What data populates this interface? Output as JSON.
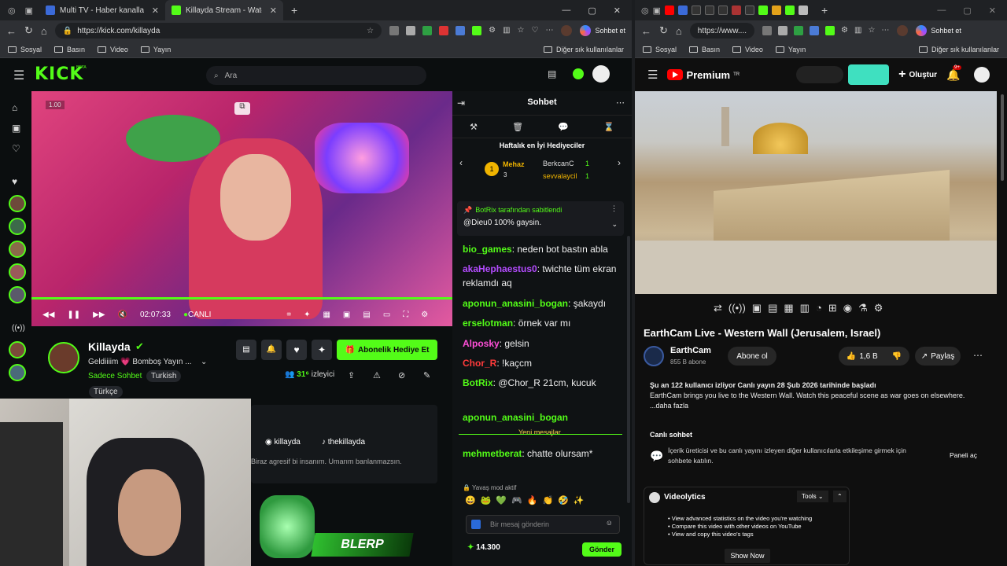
{
  "left_browser": {
    "tabs": [
      {
        "title": "Multi TV - Haber kanallarını aynı a",
        "active": false
      },
      {
        "title": "Killayda Stream - Watch Live on Ki",
        "active": true
      }
    ],
    "url": "https://kick.com/killayda",
    "copilot_label": "Sohbet et",
    "bookmarks": [
      "Sosyal",
      "Basın",
      "Video",
      "Yayın"
    ],
    "other_bookmarks": "Diğer sık kullanılanlar"
  },
  "kick": {
    "logo": "KICK",
    "logo_badge": "BETA",
    "search_placeholder": "Ara",
    "player": {
      "time": "02:07:33",
      "live_label": "CANLI",
      "speed_badge": "1.00"
    },
    "channel": {
      "name": "Killayda",
      "title": "Geldiiiim 💗 Bomboş Yayın ...",
      "category": "Sadece Sohbet",
      "tags": [
        "Turkish",
        "Türkçe"
      ],
      "viewers": "31⁶",
      "viewers_label": "izleyici",
      "gift_button": "Abonelik Hediye Et",
      "socials": [
        "killayda",
        "thekillayda"
      ],
      "bio": "Biraz agresif bi insanım. Umarım banlanmazsın.",
      "banner_text": "BLERP"
    },
    "chat": {
      "title": "Sohbet",
      "gifters_title": "Haftalık en İyi Hediyeciler",
      "gifters": [
        {
          "name": "Mehaz",
          "count": "3"
        },
        {
          "name": "BerkcanC",
          "count": "1"
        },
        {
          "name": "sevvalaycil",
          "count": "1"
        }
      ],
      "pinned_by": "BotRix tarafından sabitlendi",
      "pinned_message": "@Dieu0 100% gaysin.",
      "messages": [
        {
          "user": "bio_games",
          "color": "#53fc18",
          "text": "neden bot bastın abla"
        },
        {
          "user": "akaHephaestus0",
          "color": "#b44cff",
          "text": "twichte tüm ekran reklamdı aq"
        },
        {
          "user": "aponun_anasini_bogan",
          "color": "#53fc18",
          "text": "şakaydı"
        },
        {
          "user": "erselotman",
          "color": "#53fc18",
          "text": "örnek var mı"
        },
        {
          "user": "Alposky",
          "color": "#ff4fd8",
          "text": "gelsin"
        },
        {
          "user": "Chor_R",
          "color": "#ff3b3b",
          "text": "!kaçcm"
        },
        {
          "user": "BotRix",
          "color": "#53fc18",
          "text": "@Chor_R 21cm, kucuk"
        },
        {
          "user": "aponun_anasini_bogan",
          "color": "#53fc18",
          "text": ""
        },
        {
          "user": "mehmetberat",
          "color": "#53fc18",
          "text": "chatte olursam*"
        }
      ],
      "new_messages": "Yeni mesajlar",
      "slow_mode": "Yavaş mod aktif",
      "input_placeholder": "Bir mesaj gönderin",
      "points": "14.300",
      "send_label": "Gönder"
    }
  },
  "right_browser": {
    "url": "https://www....",
    "copilot_label": "Sohbet et",
    "bookmarks": [
      "Sosyal",
      "Basın",
      "Video",
      "Yayın"
    ],
    "other_bookmarks": "Diğer sık kullanılanlar"
  },
  "youtube": {
    "logo": "Premium",
    "logo_sup": "TR",
    "create_label": "Oluştur",
    "notif_count": "9+",
    "video_title": "EarthCam Live - Western Wall (Jerusalem, Israel)",
    "channel": "EarthCam",
    "subscribers": "855 B abone",
    "subscribe_label": "Abone ol",
    "likes": "1,6 B",
    "share_label": "Paylaş",
    "desc_stats": "Şu an 122 kullanıcı izliyor  Canlı yayın 28 Şub 2026 tarihinde başladı",
    "desc_text": "EarthCam brings you live to the Western Wall. Watch this peaceful scene as war goes on elsewhere.",
    "desc_more": "...daha fazla",
    "live_chat_title": "Canlı sohbet",
    "live_chat_text": "İçerik üreticisi ve bu canlı yayını izleyen diğer kullanıcılarla etkileşime girmek için sohbete katılın.",
    "open_panel": "Paneli aç",
    "videolytics": {
      "title": "Videolytics",
      "tools": "Tools",
      "items": [
        "View advanced statistics on the video you're watching",
        "Compare this video with other videos on YouTube",
        "View and copy this video's tags"
      ],
      "show_now": "Show Now"
    }
  },
  "colors": {
    "kick_green": "#53fc18",
    "yt_red": "#ff0000"
  }
}
